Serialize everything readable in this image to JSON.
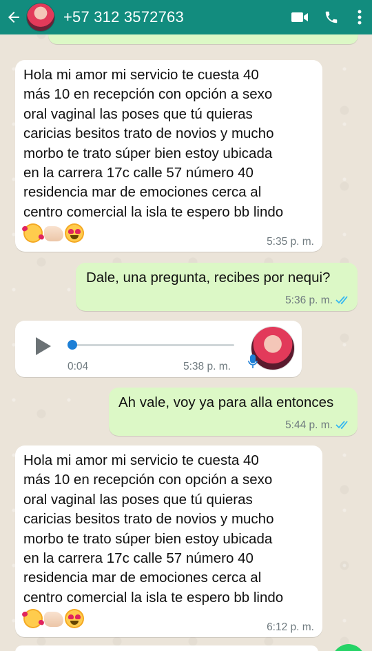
{
  "header": {
    "contact": "+57 312 3572763",
    "icons": [
      "back-arrow-icon",
      "video-call-icon",
      "voice-call-icon",
      "more-options-icon"
    ]
  },
  "colors": {
    "header": "#128c7e",
    "incoming": "#ffffff",
    "outgoing": "#dcf8c6",
    "read_ticks": "#34b7f1",
    "voice_knob": "#1d7fd6"
  },
  "messages": [
    {
      "direction": "in",
      "text": "Hola mi amor mi servicio te cuesta 40\nmás 10 en recepción con opción a sexo\noral vaginal las poses que tú quieras\ncaricias besitos trato de novios y mucho\nmorbo te trato súper bien estoy ubicada\nen la carrera 17c calle 57 número 40\nresidencia mar de emociones cerca al\ncentro comercial la isla te espero bb lindo",
      "emojis": [
        "smiling-face-with-hearts-icon",
        "thumbs-up-icon",
        "heart-eyes-icon"
      ],
      "time": "5:35 p. m."
    },
    {
      "direction": "out",
      "text": "Dale, una pregunta, recibes por nequi?",
      "time": "5:36 p. m.",
      "status": "read"
    },
    {
      "direction": "in",
      "type": "voice",
      "duration": "0:04",
      "time": "5:38 p. m.",
      "progress": 0
    },
    {
      "direction": "out",
      "text": "Ah vale, voy ya para alla entonces",
      "time": "5:44 p. m.",
      "status": "read"
    },
    {
      "direction": "in",
      "text": "Hola mi amor mi servicio te cuesta 40\nmás 10 en recepción con opción a sexo\noral vaginal las poses que tú quieras\ncaricias besitos trato de novios y mucho\nmorbo te trato súper bien estoy ubicada\nen la carrera 17c calle 57 número 40\nresidencia mar de emociones cerca al\ncentro comercial la isla te espero bb lindo",
      "emojis": [
        "smiling-face-with-hearts-icon",
        "thumbs-up-icon",
        "heart-eyes-icon"
      ],
      "time": "6:12 p. m."
    }
  ]
}
